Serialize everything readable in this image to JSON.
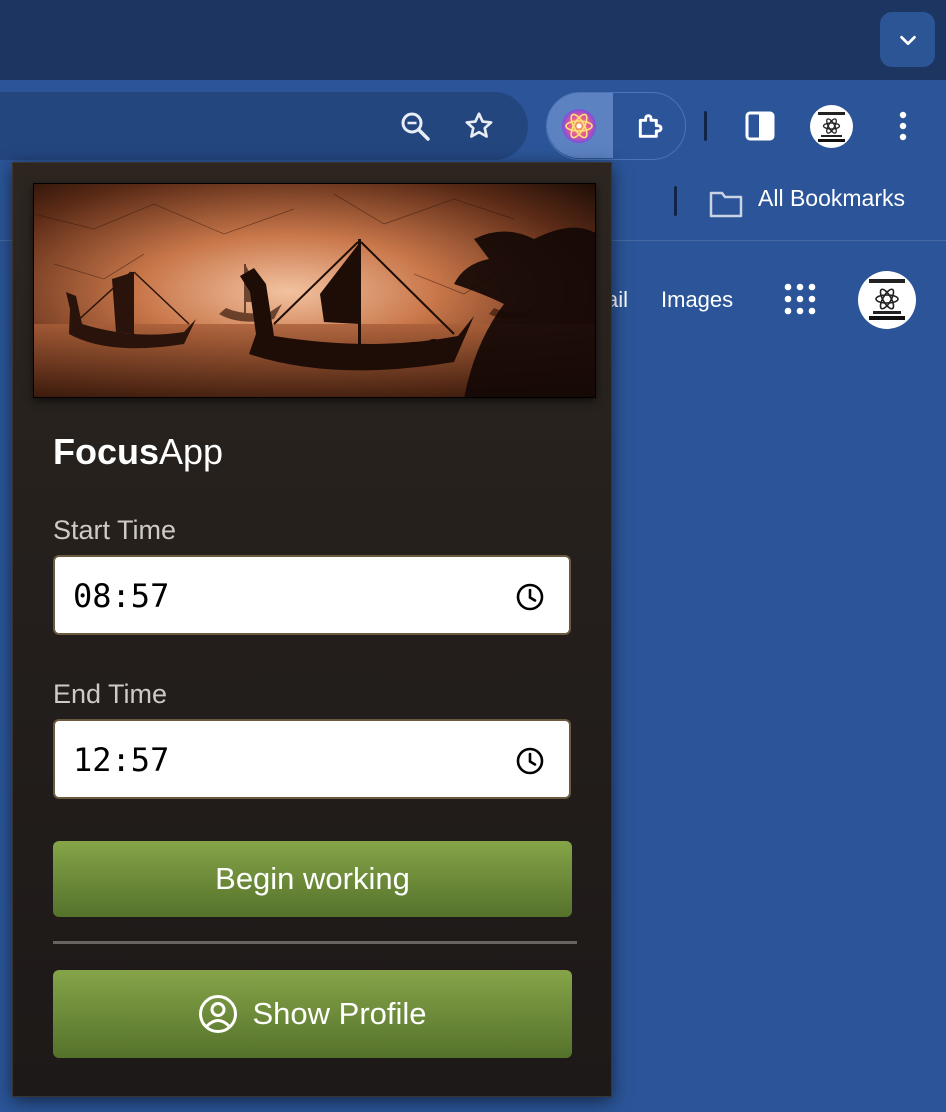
{
  "browser": {
    "bookmarks_bar": {
      "all_bookmarks_label": "All Bookmarks"
    }
  },
  "google_page": {
    "link_mail_partial": "ail",
    "link_images": "Images"
  },
  "popup": {
    "title_bold": "Focus",
    "title_rest": "App",
    "start_time": {
      "label": "Start Time",
      "value": "08:57"
    },
    "end_time": {
      "label": "End Time",
      "value": "12:57"
    },
    "begin_button": "Begin working",
    "profile_button": "Show Profile"
  },
  "colors": {
    "browser_frame": "#2b5598",
    "tabstrip": "#1c3561",
    "popup_bg": "#241f1c",
    "button_green": "#6d8b3a"
  },
  "icons": [
    "chevron-down-icon",
    "zoom-icon",
    "star-icon",
    "atom-icon",
    "puzzle-icon",
    "side-panel-icon",
    "kebab-menu-icon",
    "folder-icon",
    "apps-grid-icon",
    "clock-icon",
    "user-circle-icon"
  ]
}
